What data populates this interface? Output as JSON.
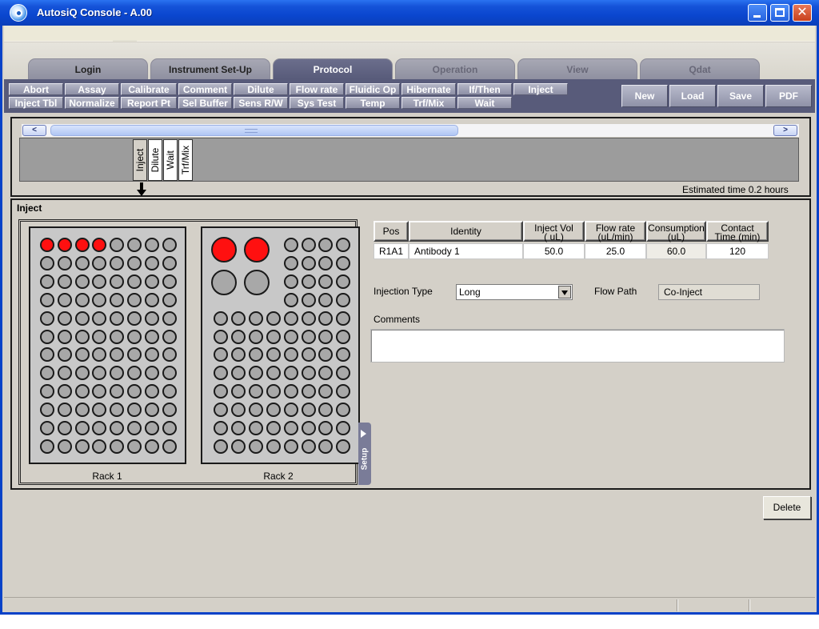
{
  "window": {
    "title": "AutosiQ Console - A.00"
  },
  "tabs": [
    {
      "label": "Login",
      "state": "normal"
    },
    {
      "label": "Instrument Set-Up",
      "state": "normal"
    },
    {
      "label": "Protocol",
      "state": "active"
    },
    {
      "label": "Operation",
      "state": "dim"
    },
    {
      "label": "View",
      "state": "dim"
    },
    {
      "label": "Qdat",
      "state": "dim"
    }
  ],
  "commands": {
    "row1": [
      "Abort",
      "Assay",
      "Calibrate",
      "Comment",
      "Dilute",
      "Flow rate",
      "Fluidic Op",
      "Hibernate",
      "If/Then",
      "Inject"
    ],
    "row2": [
      "Inject Tbl",
      "Normalize",
      "Report Pt",
      "Sel Buffer",
      "Sens R/W",
      "Sys Test",
      "Temp",
      "Trf/Mix",
      "Wait"
    ]
  },
  "file_buttons": [
    "New",
    "Load",
    "Save",
    "PDF"
  ],
  "timeline": {
    "scroll_left": "<",
    "scroll_right": ">",
    "steps": [
      "Inject",
      "Dilute",
      "Wait",
      "Trf/Mix"
    ],
    "selected_step": 0,
    "estimated_time": "Estimated time  0.2 hours"
  },
  "inject": {
    "title": "Inject",
    "racks": [
      {
        "label": "Rack 1",
        "used_wells": 4
      },
      {
        "label": "Rack 2",
        "used_large_wells": 2
      }
    ],
    "setup_tab": "Setup",
    "grid": {
      "headers": [
        "Pos",
        "Identity",
        "Inject Vol\n( uL)",
        "Flow rate\n(uL/min)",
        "Consumption\n(uL)",
        "Contact\nTime (min)"
      ],
      "rows": [
        [
          "R1A1",
          "Antibody 1",
          "50.0",
          "25.0",
          "60.0",
          "120"
        ]
      ]
    },
    "injection_type": {
      "label": "Injection Type",
      "value": "Long"
    },
    "flow_path": {
      "label": "Flow Path",
      "value": "Co-Inject"
    },
    "comments": {
      "label": "Comments",
      "value": ""
    }
  },
  "delete_label": "Delete",
  "colors": {
    "used_well": "#ff1010",
    "empty_well": "#a8a8a8",
    "accent": "#585b7a"
  }
}
